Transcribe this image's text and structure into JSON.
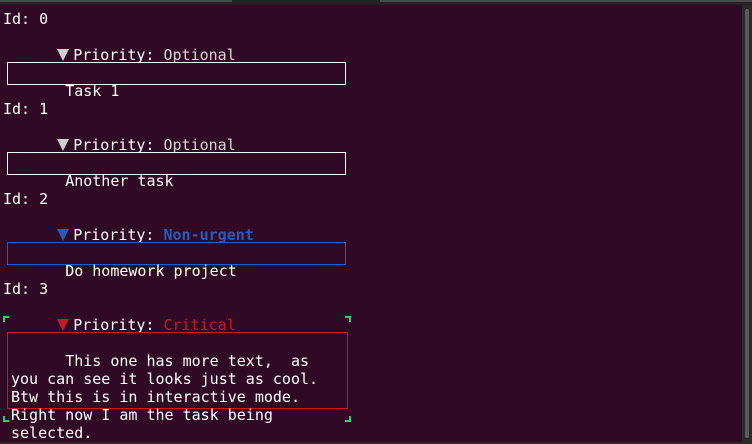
{
  "colors": {
    "terminal_bg": "#300a24",
    "optional": "#d7d7d7",
    "non_urgent": "#2a5ab8",
    "critical": "#c01c28",
    "selection_corner": "#27d27b"
  },
  "tasks": [
    {
      "id_label": "Id: 0",
      "priority_label": "Priority: ",
      "priority_value": "Optional",
      "text": "Task 1"
    },
    {
      "id_label": "Id: 1",
      "priority_label": "Priority: ",
      "priority_value": "Optional",
      "text": "Another task"
    },
    {
      "id_label": "Id: 2",
      "priority_label": "Priority: ",
      "priority_value": "Non-urgent",
      "text": "Do homework project"
    },
    {
      "id_label": "Id: 3",
      "priority_label": "Priority: ",
      "priority_value": "Critical",
      "text": "This one has more text,  as you can see it looks just as cool. Btw this is in interactive mode. Right now I am the task being selected."
    }
  ]
}
